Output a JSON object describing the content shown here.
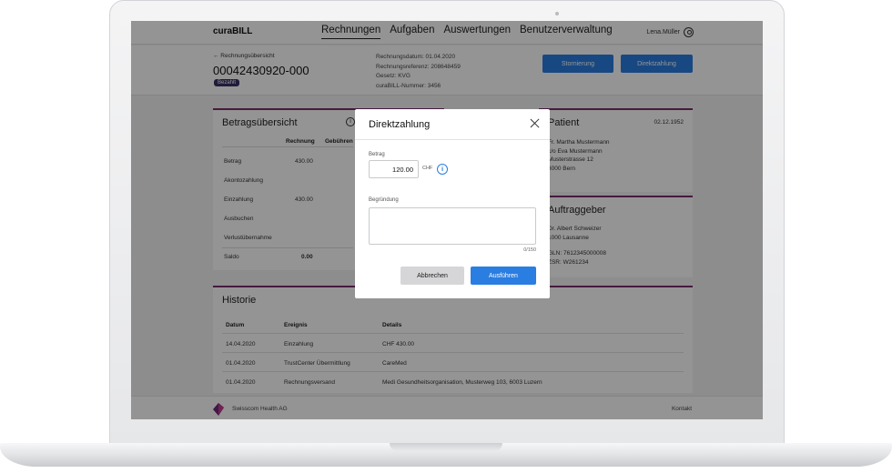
{
  "app": {
    "brand": "curaBILL"
  },
  "nav": [
    {
      "label": "Rechnungen",
      "active": true
    },
    {
      "label": "Aufgaben"
    },
    {
      "label": "Auswertungen"
    },
    {
      "label": "Benutzerverwaltung"
    }
  ],
  "user": {
    "name": "Lena.Müller",
    "icon": "user-icon"
  },
  "header": {
    "back_label": "← Rechnungsübersicht",
    "invoice_number": "00042430920-000",
    "status_badge": "Bezahlt",
    "meta": [
      "Rechnungsdatum: 01.04.2020",
      "Rechnungsreferenz: 208648459",
      "Gesetz: KVG",
      "curaBILL-Nummer: 3456"
    ],
    "storno_label": "Stornierung",
    "direkt_label": "Direktzahlung"
  },
  "betrag": {
    "title": "Betragsübersicht",
    "col_rechnung": "Rechnung",
    "col_gebuehren": "Gebühren",
    "rows": [
      {
        "label": "Betrag",
        "value": "430.00"
      },
      {
        "label": "Akontozahlung",
        "value": ""
      },
      {
        "label": "Einzahlung",
        "value": "430.00"
      },
      {
        "label": "Ausbuchen",
        "value": ""
      },
      {
        "label": "Verlustübernahme",
        "value": ""
      },
      {
        "label": "Saldo",
        "value": "0.00"
      }
    ]
  },
  "patient": {
    "title": "Patient",
    "date": "02.12.1952",
    "lines": [
      "Fr. Martha Mustermann",
      "c/o Eva Mustermann",
      "Musterstrasse 12",
      "3000 Bern"
    ]
  },
  "auftraggeber": {
    "title": "Auftraggeber",
    "lines1": [
      "Dr. Albert Schweizer",
      "1000 Lausanne"
    ],
    "lines2": [
      "GLN: 7612345000008",
      "ZSR: W261234"
    ]
  },
  "historie": {
    "title": "Historie",
    "headers": [
      "Datum",
      "Ereignis",
      "Details"
    ],
    "rows": [
      {
        "date": "14.04.2020",
        "event": "Einzahlung",
        "details": "CHF 430.00"
      },
      {
        "date": "01.04.2020",
        "event": "TrustCenter Übermittlung",
        "details": "CareMed"
      },
      {
        "date": "01.04.2020",
        "event": "Rechnungsversand",
        "details": "Medi Gesundheitsorganisation, Musterweg 103, 6003 Luzern"
      }
    ]
  },
  "footer": {
    "company": "Swisscom Health AG",
    "contact": "Kontakt"
  },
  "modal": {
    "title": "Direktzahlung",
    "amount_label": "Betrag",
    "amount_value": "120.00",
    "currency": "CHF",
    "reason_label": "Begründung",
    "reason_value": "",
    "counter": "0/150",
    "cancel_label": "Abbrechen",
    "execute_label": "Ausführen"
  },
  "colors": {
    "primary": "#2a7de1",
    "accent": "#7b2d6c",
    "badge": "#3a2f64"
  }
}
